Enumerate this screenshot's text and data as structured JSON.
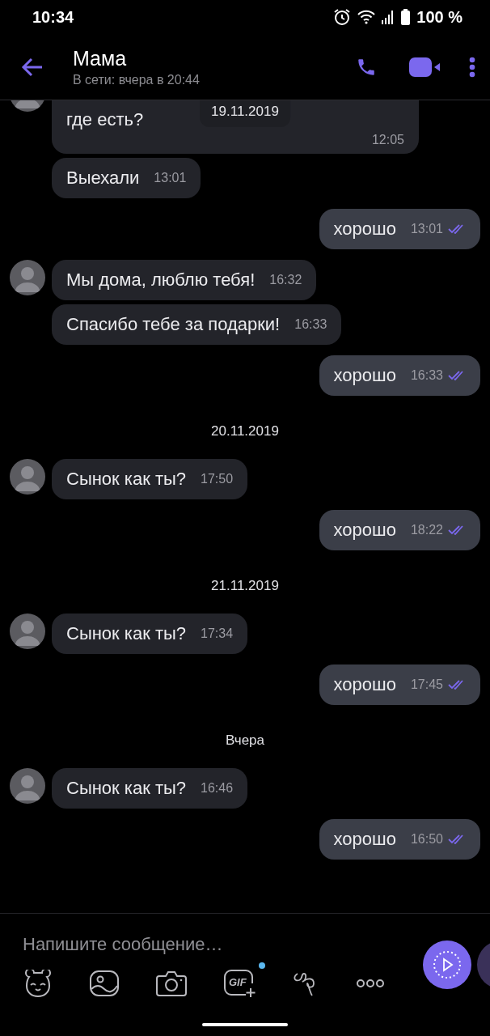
{
  "status_bar": {
    "time": "10:34",
    "battery": "100 %"
  },
  "header": {
    "title": "Мама",
    "subtitle": "В сети: вчера в 20:44"
  },
  "floating_date": "19.11.2019",
  "messages": [
    {
      "kind": "in",
      "avatar": true,
      "continued": true,
      "text": "где есть?",
      "time": "12:05"
    },
    {
      "kind": "in",
      "avatar": false,
      "text": "Выехали",
      "time": "13:01"
    },
    {
      "kind": "out",
      "text": "хорошо",
      "time": "13:01",
      "read": true
    },
    {
      "kind": "in",
      "avatar": true,
      "text": "Мы дома, люблю тебя!",
      "time": "16:32"
    },
    {
      "kind": "in",
      "avatar": false,
      "text": "Спасибо тебе за подарки!",
      "time": "16:33"
    },
    {
      "kind": "out",
      "text": "хорошо",
      "time": "16:33",
      "read": true
    },
    {
      "kind": "date",
      "text": "20.11.2019"
    },
    {
      "kind": "in",
      "avatar": true,
      "text": "Сынок как ты?",
      "time": "17:50"
    },
    {
      "kind": "out",
      "text": "хорошо",
      "time": "18:22",
      "read": true
    },
    {
      "kind": "date",
      "text": "21.11.2019"
    },
    {
      "kind": "in",
      "avatar": true,
      "text": "Сынок как ты?",
      "time": "17:34"
    },
    {
      "kind": "out",
      "text": "хорошо",
      "time": "17:45",
      "read": true
    },
    {
      "kind": "date",
      "text": "Вчера"
    },
    {
      "kind": "in",
      "avatar": true,
      "text": "Сынок как ты?",
      "time": "16:46"
    },
    {
      "kind": "out",
      "text": "хорошо",
      "time": "16:50",
      "read": true
    }
  ],
  "composer": {
    "placeholder": "Напишите сообщение…",
    "gif_label": "GIF",
    "gif_new": true
  }
}
